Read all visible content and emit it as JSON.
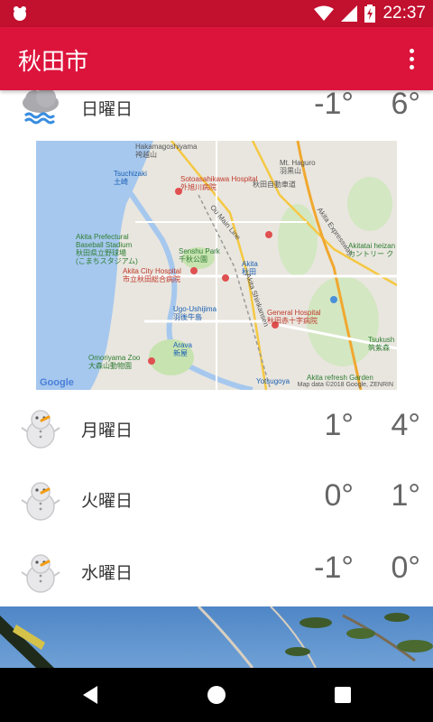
{
  "status_bar": {
    "time": "22:37",
    "icons": [
      "notification-icon",
      "wifi-icon",
      "signal-icon",
      "battery-charging-icon"
    ]
  },
  "app_bar": {
    "title": "秋田市",
    "overflow_icon": "more-vert-icon"
  },
  "colors": {
    "status_bar": "#c2102f",
    "app_bar": "#dc143c",
    "text_temp": "#666666"
  },
  "forecast": [
    {
      "day": "日曜日",
      "min": "-1°",
      "max": "6°",
      "icon": "snow-wind-cloud-icon"
    },
    {
      "day": "月曜日",
      "min": "1°",
      "max": "4°",
      "icon": "snowman-icon"
    },
    {
      "day": "火曜日",
      "min": "0°",
      "max": "1°",
      "icon": "snowman-icon"
    },
    {
      "day": "水曜日",
      "min": "-1°",
      "max": "0°",
      "icon": "snowman-icon"
    }
  ],
  "map": {
    "google_logo": "Google",
    "attribution": "Map data ©2018 Google, ZENRIN",
    "labels": [
      {
        "text": "Hakamagoshiyama",
        "sub": "袴越山"
      },
      {
        "text": "Sotoasahikawa Hospital",
        "sub": "外旭川病院"
      },
      {
        "text": "Mt. Haguro",
        "sub": "羽黒山"
      },
      {
        "text": "Akita Prefectural",
        "sub": "Baseball Stadium"
      },
      {
        "text": "秋田県立野球場",
        "sub": "(こまちスタジアム)"
      },
      {
        "text": "Senshu Park",
        "sub": "千秋公園"
      },
      {
        "text": "Akitatai heizan",
        "sub": "カントリー ク"
      },
      {
        "text": "Akita City Hospital",
        "sub": "市立秋田総合病院"
      },
      {
        "text": "Akita",
        "sub": "秋田"
      },
      {
        "text": "Ugo-Ushijima",
        "sub": "羽後牛島"
      },
      {
        "text": "General Hospital",
        "sub": "秋田赤十字病院"
      },
      {
        "text": "Omoriyama Zoo",
        "sub": "大森山動物園"
      },
      {
        "text": "Arava",
        "sub": "新屋"
      },
      {
        "text": "Tsukush",
        "sub": "筑紫森"
      },
      {
        "text": "Yotsugoya",
        "sub": "四ツ小屋"
      },
      {
        "text": "Akita refresh Garden",
        "sub": ""
      },
      {
        "text": "Tsuchizaki",
        "sub": "土崎"
      },
      {
        "text": "Ou Main Line",
        "sub": ""
      },
      {
        "text": "Akita Shinkansen",
        "sub": ""
      },
      {
        "text": "Akita Expressway",
        "sub": ""
      },
      {
        "text": "秋田自動車道",
        "sub": ""
      }
    ]
  },
  "nav_bar": {
    "back": "back-icon",
    "home": "home-icon",
    "recents": "recents-icon"
  }
}
